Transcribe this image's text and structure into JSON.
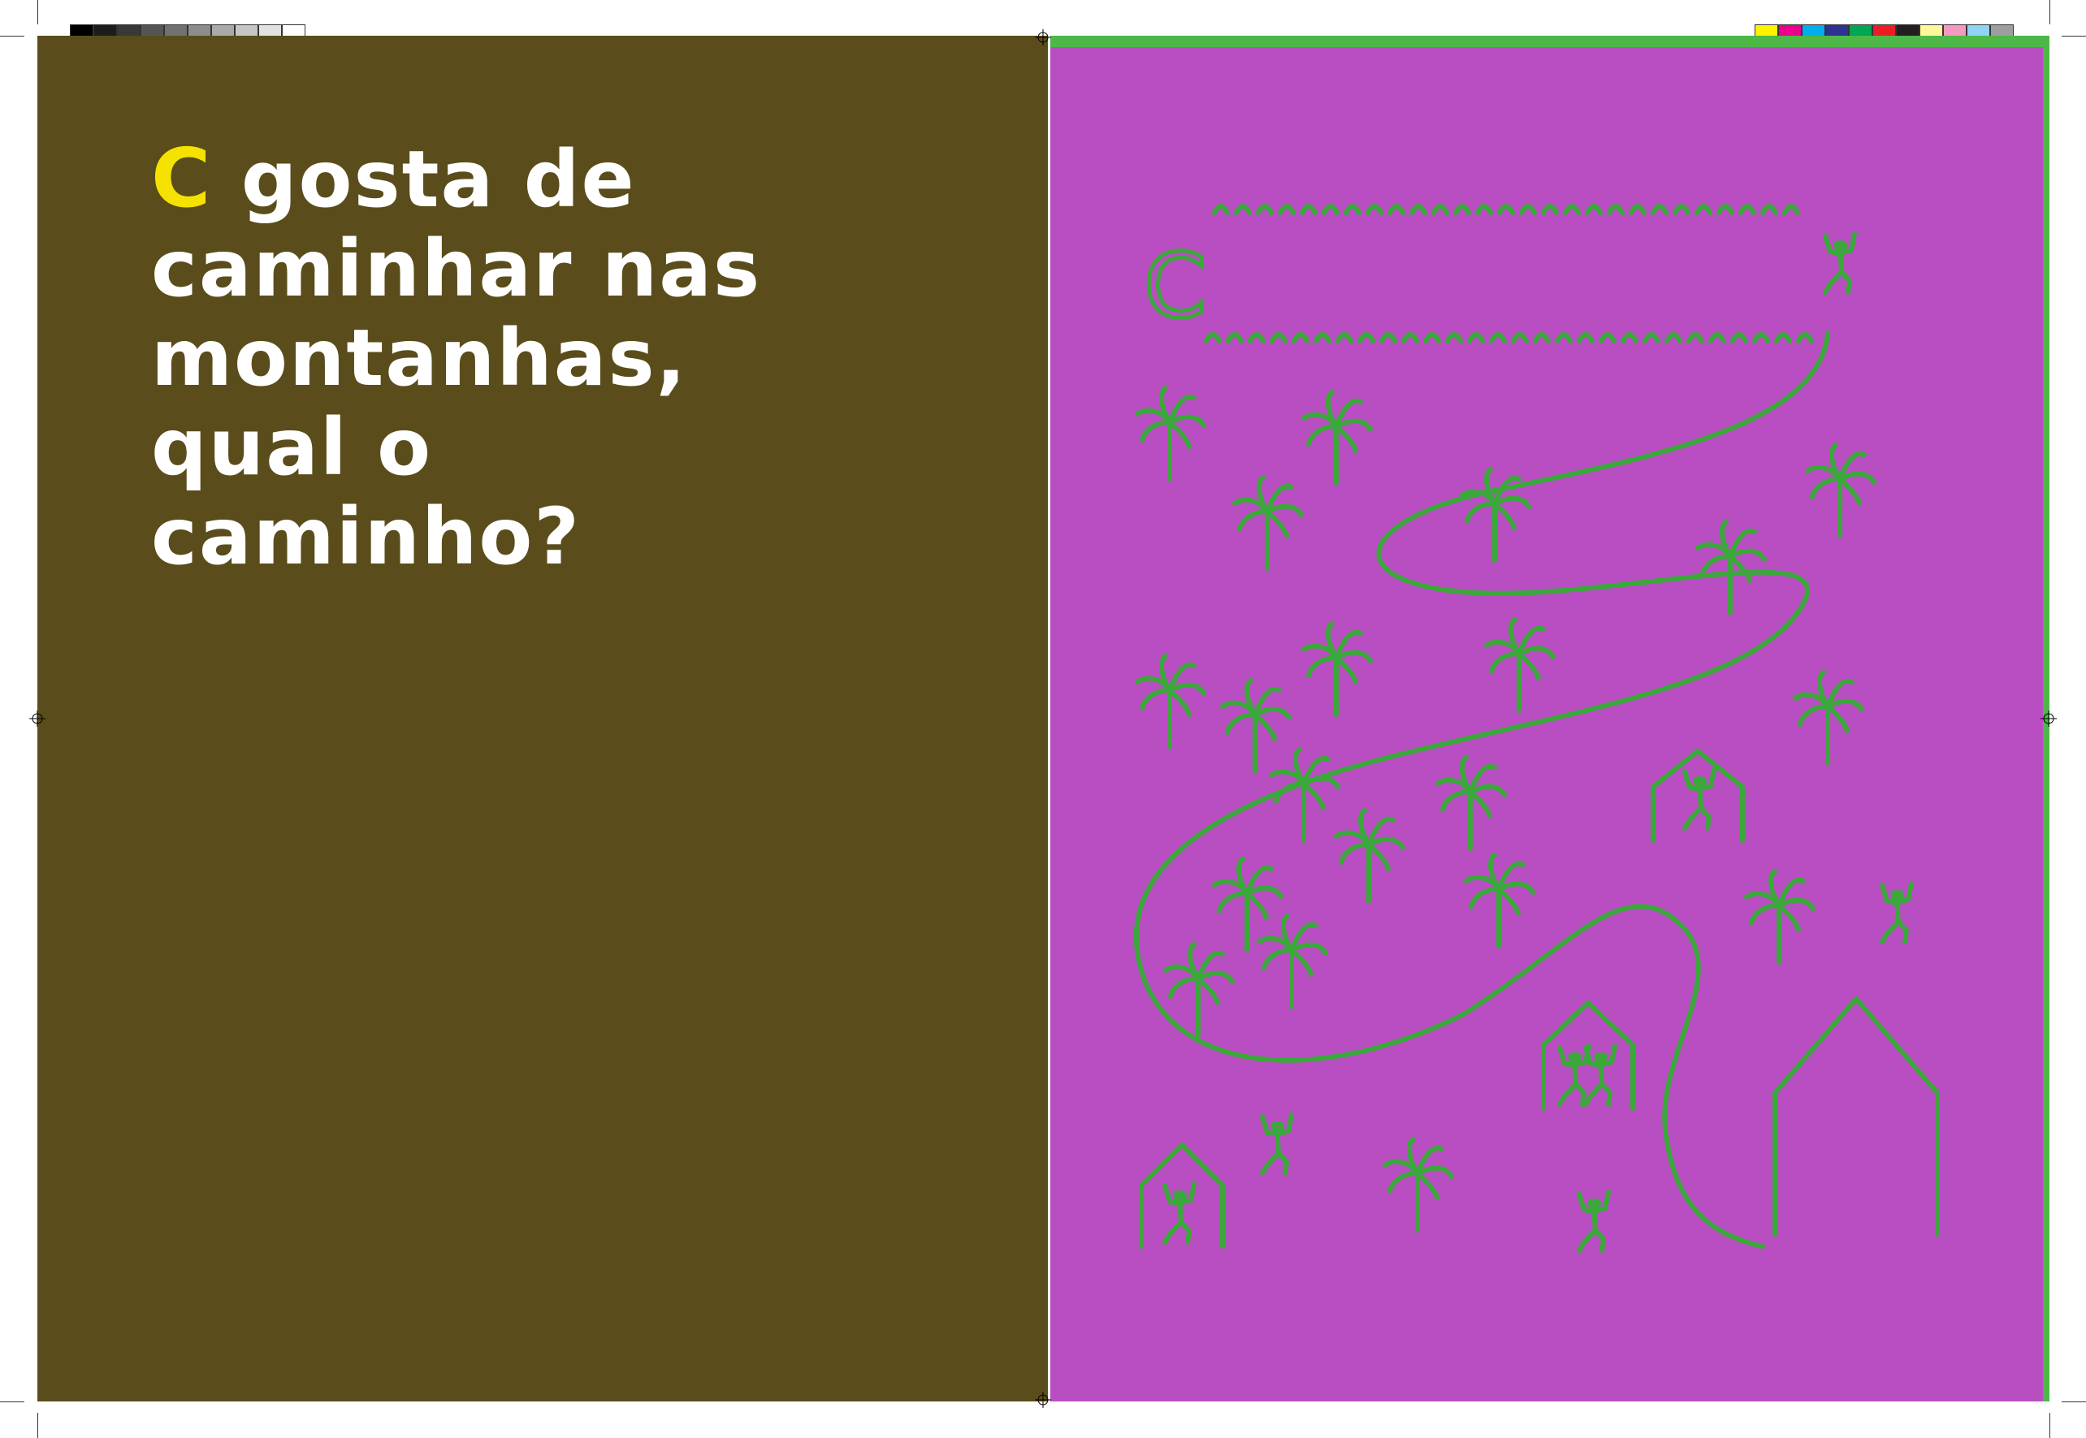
{
  "colors": {
    "left_page_background": "#5a4d1b",
    "right_page_background": "#b94ec2",
    "drawing_stroke": "#3aa83a",
    "heading_text": "#ffffff",
    "heading_accent": "#f5e200",
    "green_border": "#4db848",
    "greyscale_swatches": [
      "#000000",
      "#1c1c1c",
      "#383838",
      "#555555",
      "#717171",
      "#8d8d8d",
      "#aaaaaa",
      "#c6c6c6",
      "#e2e2e2",
      "#ffffff"
    ],
    "process_swatches": [
      "#fff200",
      "#ec008c",
      "#00aeef",
      "#2e3192",
      "#00a651",
      "#ed1c24",
      "#231f20",
      "#fff799",
      "#f49ac1",
      "#8fd3f5",
      "#9e9e9e"
    ]
  },
  "heading": {
    "first_letter": "C",
    "rest": "gosta de caminhar nas montanhas, qual o caminho?"
  },
  "drawing": {
    "start_letter": "C"
  },
  "icons": [
    "registration-mark-icon",
    "palm-tree-icon",
    "house-icon",
    "person-icon"
  ]
}
